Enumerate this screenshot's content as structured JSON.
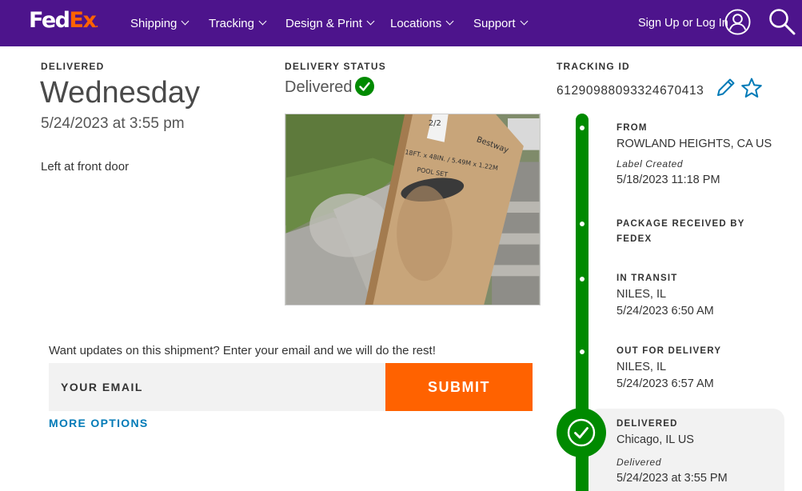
{
  "header": {
    "logo_fed": "Fed",
    "logo_ex": "Ex",
    "logo_dot": ".",
    "nav": [
      {
        "label": "Shipping"
      },
      {
        "label": "Tracking"
      },
      {
        "label": "Design & Print"
      },
      {
        "label": "Locations"
      },
      {
        "label": "Support"
      }
    ],
    "signup_label": "Sign Up or Log In",
    "brand_purple": "#4d148c",
    "brand_orange": "#ff6200"
  },
  "delivered": {
    "label": "DELIVERED",
    "day": "Wednesday",
    "datetime": "5/24/2023 at 3:55 pm",
    "note": "Left at front door"
  },
  "status": {
    "label": "DELIVERY STATUS",
    "value": "Delivered",
    "color": "#008a00",
    "photo_text": [
      "2/2",
      "Bestway",
      "18FT. x 48IN. / 5.49M x 1.22M",
      "POOL SET"
    ]
  },
  "tracking": {
    "label": "TRACKING ID",
    "number": "612909880933246704​13"
  },
  "email": {
    "prompt": "Want updates on this shipment? Enter your email and we will do the rest!",
    "placeholder": "YOUR EMAIL",
    "submit_label": "SUBMIT",
    "more_options": "MORE OPTIONS"
  },
  "timeline": {
    "from": {
      "title": "FROM",
      "location": "ROWLAND HEIGHTS, CA US",
      "sub": "Label Created",
      "datetime": "5/18/2023 11:18 PM"
    },
    "received": {
      "title_line1": "PACKAGE RECEIVED BY",
      "title_line2": "FEDEX"
    },
    "in_transit": {
      "title": "IN TRANSIT",
      "location": "NILES, IL",
      "datetime": "5/24/2023 6:50 AM"
    },
    "out_for_delivery": {
      "title": "OUT FOR DELIVERY",
      "location": "NILES, IL",
      "datetime": "5/24/2023 6:57 AM"
    },
    "delivered": {
      "title": "DELIVERED",
      "location": "Chicago, IL US",
      "sub": "Delivered",
      "datetime": "5/24/2023 at 3:55 PM"
    }
  }
}
